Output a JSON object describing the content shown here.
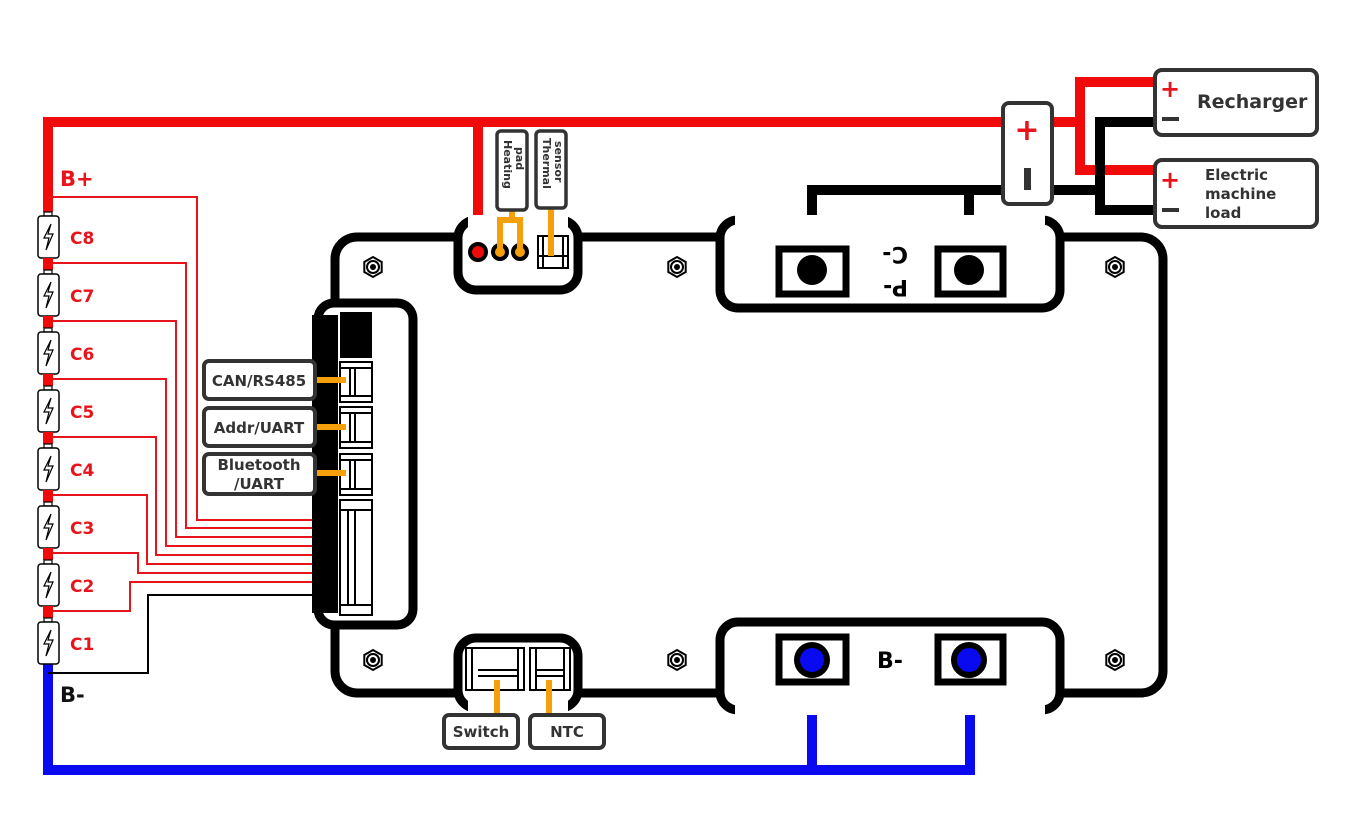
{
  "colors": {
    "positive": "#f00a0a",
    "negative": "#0a0af0",
    "signal": "#f5a00a",
    "outline": "#000000",
    "sense": "#e8141b"
  },
  "battery": {
    "positive_label": "B+",
    "negative_label": "B-",
    "cells": [
      "C8",
      "C7",
      "C6",
      "C5",
      "C4",
      "C3",
      "C2",
      "C1"
    ],
    "cell_icon": "battery-bolt-icon"
  },
  "top_connectors": {
    "heating_l1": "Heating",
    "heating_l2": "pad",
    "thermal_l1": "Thermal",
    "thermal_l2": "sensor"
  },
  "side_ports": {
    "can": "CAN/RS485",
    "addr": "Addr/UART",
    "bt_l1": "Bluetooth",
    "bt_l2": "/UART"
  },
  "bottom_ports": {
    "switch": "Switch",
    "ntc": "NTC"
  },
  "terminals": {
    "p_minus": "P-",
    "c_minus": "C-",
    "b_minus": "B-"
  },
  "output": {
    "plus": "+",
    "recharger": "Recharger",
    "load_l1": "Electric",
    "load_l2": "machine",
    "load_l3": "load"
  }
}
